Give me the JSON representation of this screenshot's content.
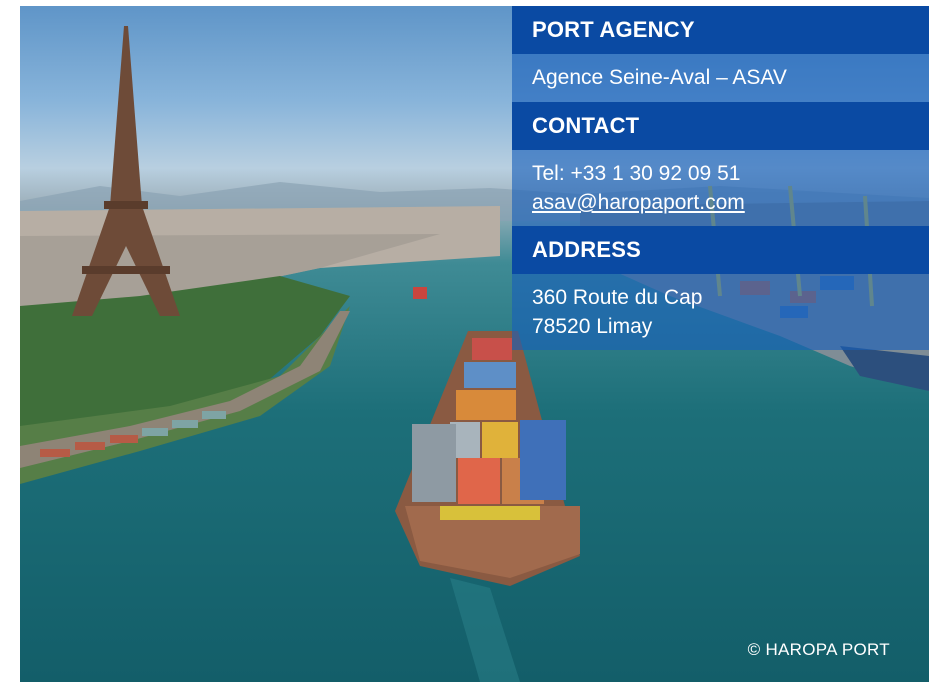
{
  "port_agency": {
    "title": "PORT AGENCY",
    "name": "Agence Seine-Aval – ASAV"
  },
  "contact": {
    "title": "CONTACT",
    "tel": "Tel: +33 1 30 92 09 51",
    "email": "asav@haropaport.com"
  },
  "address": {
    "title": "ADDRESS",
    "line1": "360 Route du Cap",
    "line2": "78520 Limay"
  },
  "copyright": "© HAROPA PORT",
  "colors": {
    "header_blue": "#0a4aa3",
    "panel_blue": "#195fb9",
    "river": "#1d6f79"
  }
}
